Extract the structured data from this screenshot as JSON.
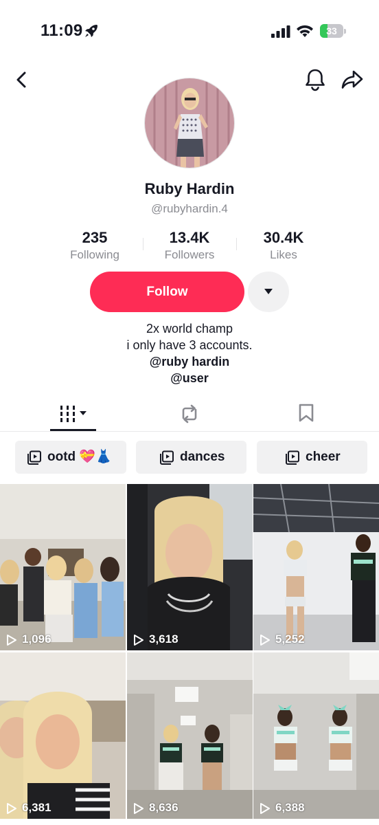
{
  "status_bar": {
    "time": "11:09",
    "battery_level": "33",
    "battery_fraction": 0.33
  },
  "profile": {
    "display_name": "Ruby Hardin",
    "username": "@rubyhardin.4"
  },
  "stats": [
    {
      "value": "235",
      "label": "Following"
    },
    {
      "value": "13.4K",
      "label": "Followers"
    },
    {
      "value": "30.4K",
      "label": "Likes"
    }
  ],
  "actions": {
    "follow_label": "Follow"
  },
  "bio": {
    "line1": "2x world champ",
    "line2": "i only have 3 accounts.",
    "mention1": "@ruby hardin",
    "mention2": "@user"
  },
  "tabs": [
    {
      "icon": "grid-icon",
      "active": true
    },
    {
      "icon": "repost-icon",
      "active": false
    },
    {
      "icon": "bookmark-icon",
      "active": false
    }
  ],
  "playlists": [
    {
      "label": "ootd 💝👗",
      "icon": "playlist-icon"
    },
    {
      "label": "dances",
      "icon": "playlist-icon"
    },
    {
      "label": "cheer",
      "icon": "playlist-icon"
    }
  ],
  "videos": [
    {
      "views": "1,096"
    },
    {
      "views": "3,618"
    },
    {
      "views": "5,252"
    },
    {
      "views": "6,381"
    },
    {
      "views": "8,636"
    },
    {
      "views": "6,388"
    }
  ],
  "colors": {
    "accent": "#fe2c55",
    "text": "#161823",
    "muted": "#8a8b91",
    "chip_bg": "#f1f1f2"
  }
}
